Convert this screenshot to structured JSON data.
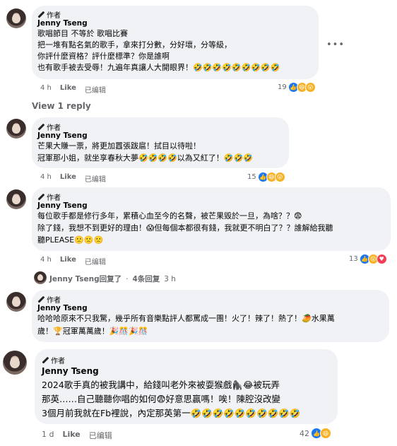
{
  "comments": [
    {
      "author_badge": "作者",
      "name": "Jenny Tseng",
      "lines": [
        "歌唱節目 不等於 歌唱比賽",
        "把一堆有點名氣的歌手，拿來打分數，分好壞，分等級，",
        "你評什麼資格？評什麼標準？你是誰啊",
        "也有歌手被去受辱！九遍年真讓人大開眼界！🤣🤣🤣🤣🤣🤣🤣🤣🤣"
      ],
      "time": "4 h",
      "like": "Like",
      "reply": "已编辑",
      "reaction_count": "19",
      "reactions": [
        "like",
        "haha",
        "wow"
      ]
    },
    {
      "author_badge": "作者",
      "name": "Jenny Tseng",
      "lines": [
        "芒果大賺一票，將更加囂張跋扈！拭目以待啦！",
        "冠軍那小姐，就坐享春秋大夢🤣🤣🤣🤣以為又紅了！🤣🤣🤣"
      ],
      "time": "4 h",
      "like": "Like",
      "reply": "已编辑",
      "reaction_count": "15",
      "reactions": [
        "like",
        "haha",
        "wow"
      ]
    },
    {
      "author_badge": "作者",
      "name": "Jenny Tseng",
      "lines": [
        "每位歌手都是修行多年，累積心血至今的名聲，被芒果毀於一旦，為啥？？😨",
        "除了錢，我想不到更好的理由！😱但每個本都很有錢，我就更不明白了？？誰解給我聽",
        "聽PLEASE🙁🙁🙁"
      ],
      "time": "4 h",
      "like": "Like",
      "reply": "已编辑",
      "reaction_count": "13",
      "reactions": [
        "like",
        "wow",
        "love"
      ]
    },
    {
      "author_badge": "作者",
      "name": "Jenny Tseng",
      "lines": [
        "哈哈哈原來不只我驚，幾乎所有音樂點評人都罵成一團！火了！辣了！熱了！🥭水果萬",
        "歲！🏆冠軍萬萬歲！🎉🎊🎉🎊"
      ],
      "time": "",
      "like": "",
      "reply": "",
      "reaction_count": "",
      "reactions": []
    },
    {
      "author_badge": "作者",
      "name": "Jenny Tseng",
      "lines": [
        "2024歌手真的被我講中，給錢叫老外來被耍猴戲🦍😂被玩弄",
        "那英……自己聽聽你唱的如何😨好意思贏嗎！唉！陳腔沒改變",
        "3個月前我就在Fb裡說，內定那英第一🤣🤣🤣🤣🤣🤣🤣🤣🤣🤣"
      ],
      "time": "1 d",
      "like": "Like",
      "reply": "已编辑",
      "reaction_count": "42",
      "reactions": [
        "like",
        "haha"
      ]
    }
  ],
  "view_reply": "View 1 reply",
  "reply_summary": {
    "name": "Jenny Tseng回复了",
    "sep": "·",
    "count": "4条回复",
    "time": "3 h"
  },
  "more_icon": "•••"
}
